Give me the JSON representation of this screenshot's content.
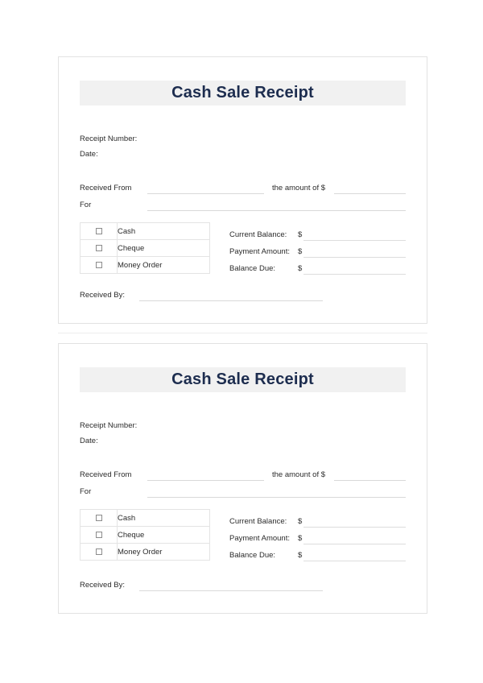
{
  "document": {
    "receipts": [
      {
        "title": "Cash Sale Receipt",
        "meta": {
          "receipt_number_label": "Receipt Number:",
          "date_label": "Date:"
        },
        "entries": {
          "received_from_label": "Received From",
          "amount_of_label": "the amount of $",
          "for_label": "For"
        },
        "payment_methods": [
          {
            "label": "Cash",
            "checked": false
          },
          {
            "label": "Cheque",
            "checked": false
          },
          {
            "label": "Money Order",
            "checked": false
          }
        ],
        "balances": [
          {
            "label": "Current Balance:",
            "currency": "$",
            "value": ""
          },
          {
            "label": "Payment Amount:",
            "currency": "$",
            "value": ""
          },
          {
            "label": "Balance Due:",
            "currency": "$",
            "value": ""
          }
        ],
        "received_by_label": "Received By:"
      },
      {
        "title": "Cash Sale Receipt",
        "meta": {
          "receipt_number_label": "Receipt Number:",
          "date_label": "Date:"
        },
        "entries": {
          "received_from_label": "Received From",
          "amount_of_label": "the amount of $",
          "for_label": "For"
        },
        "payment_methods": [
          {
            "label": "Cash",
            "checked": false
          },
          {
            "label": "Cheque",
            "checked": false
          },
          {
            "label": "Money Order",
            "checked": false
          }
        ],
        "balances": [
          {
            "label": "Current Balance:",
            "currency": "$",
            "value": ""
          },
          {
            "label": "Payment Amount:",
            "currency": "$",
            "value": ""
          },
          {
            "label": "Balance Due:",
            "currency": "$",
            "value": ""
          }
        ],
        "received_by_label": "Received By:"
      }
    ]
  },
  "colors": {
    "title_text": "#1d2d4f",
    "title_banner_bg": "#f1f1f1",
    "body_text": "#2b2b2b",
    "rule_line": "#d9d9d9",
    "table_border": "#e4e4e4",
    "card_border": "#e2e2e2",
    "page_bg": "#ffffff"
  }
}
